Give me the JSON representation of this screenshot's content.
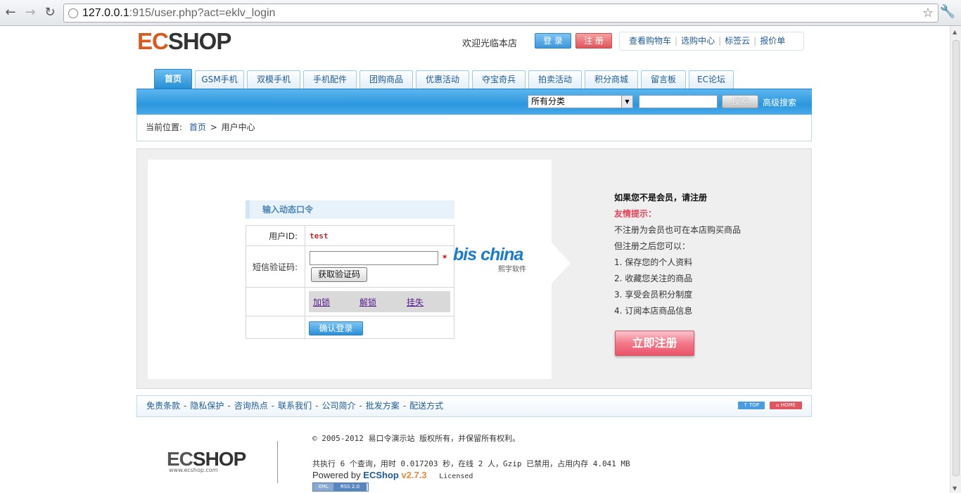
{
  "browser": {
    "url_host": "127.0.0.1",
    "url_rest": ":915/user.php?act=eklv_login"
  },
  "header": {
    "logo_ec": "EC",
    "logo_shop": "SHOP",
    "welcome": "欢迎光临本店",
    "login_label": "登 录",
    "register_label": "注 册",
    "links": [
      "查看购物车",
      "选购中心",
      "标签云",
      "报价单"
    ]
  },
  "nav": {
    "tabs": [
      "首页",
      "GSM手机",
      "双模手机",
      "手机配件",
      "团购商品",
      "优惠活动",
      "夺宝奇兵",
      "拍卖活动",
      "积分商城",
      "留言板",
      "EC论坛"
    ]
  },
  "search": {
    "category_value": "所有分类",
    "search_button": "搜索",
    "advanced_link": "高级搜索"
  },
  "breadcrumb": {
    "prefix": "当前位置:",
    "home": "首页",
    "separator": ">",
    "current": "用户中心"
  },
  "login_form": {
    "title": "输入动态口令",
    "user_id_label": "用户ID:",
    "user_id_value": "test",
    "sms_label": "短信验证码:",
    "required_mark": "*",
    "get_code_button": "获取验证码",
    "actions": [
      "加锁",
      "解锁",
      "挂失"
    ],
    "submit_button": "确认登录"
  },
  "brand": {
    "name": "bis china",
    "sub": "熙宇软件"
  },
  "register_info": {
    "heading": "如果您不是会员，请注册",
    "tip_label": "友情提示：",
    "line1": "不注册为会员也可在本店购买商品",
    "line2": "但注册之后您可以：",
    "benefits": [
      "1. 保存您的个人资料",
      "2. 收藏您关注的商品",
      "3. 享受会员积分制度",
      "4. 订阅本店商品信息"
    ],
    "register_button": "立即注册"
  },
  "footer": {
    "links": [
      "免责条款",
      "隐私保护",
      "咨询热点",
      "联系我们",
      "公司简介",
      "批发方案",
      "配送方式"
    ],
    "top_btn": "↑ TOP",
    "home_btn": "⌂ HOME",
    "logo_ec": "EC",
    "logo_shop": "SHOP",
    "logo_url": "www.ecshop.com",
    "copyright": "© 2005-2012 易口令演示站 版权所有，并保留所有权利。",
    "stats": "共执行 6 个查询，用时 0.017203 秒，在线 2 人，Gzip 已禁用，占用内存 4.041 MB",
    "powered_by": "Powered by",
    "powered_name": "ECShop",
    "powered_version": "v2.7.3",
    "licensed": "Licensed",
    "badge_xml": "XML",
    "badge_rss": "RSS 2.0"
  },
  "colors": {
    "accent_blue": "#2b97de",
    "register_red": "#e95569",
    "logo_orange": "#d75a1f"
  }
}
